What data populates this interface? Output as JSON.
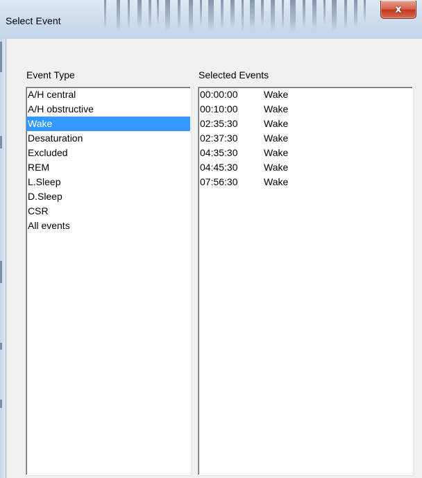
{
  "window": {
    "title": "Select Event",
    "close_glyph": "x",
    "close_icon": "close-icon"
  },
  "event_type": {
    "label": "Event Type",
    "items": [
      {
        "label": "A/H central",
        "selected": false
      },
      {
        "label": "A/H obstructive",
        "selected": false
      },
      {
        "label": "Wake",
        "selected": true
      },
      {
        "label": "Desaturation",
        "selected": false
      },
      {
        "label": "Excluded",
        "selected": false
      },
      {
        "label": "REM",
        "selected": false
      },
      {
        "label": "L.Sleep",
        "selected": false
      },
      {
        "label": "D.Sleep",
        "selected": false
      },
      {
        "label": "CSR",
        "selected": false
      },
      {
        "label": "All events",
        "selected": false
      }
    ]
  },
  "selected_events": {
    "label": "Selected Events",
    "rows": [
      {
        "time": "00:00:00",
        "type": "Wake"
      },
      {
        "time": "00:10:00",
        "type": "Wake"
      },
      {
        "time": "02:35:30",
        "type": "Wake"
      },
      {
        "time": "02:37:30",
        "type": "Wake"
      },
      {
        "time": "04:35:30",
        "type": "Wake"
      },
      {
        "time": "04:45:30",
        "type": "Wake"
      },
      {
        "time": "07:56:30",
        "type": "Wake"
      }
    ]
  },
  "colors": {
    "selection": "#3399ff",
    "close_button": "#c2391f",
    "dialog_background": "#f0f0f0"
  }
}
